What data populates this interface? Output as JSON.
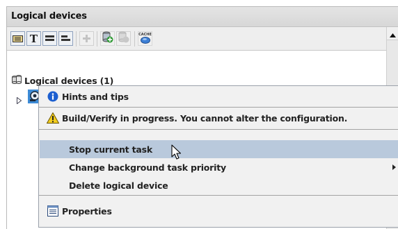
{
  "panel": {
    "title": "Logical devices"
  },
  "toolbar": {
    "buttons": [
      {
        "name": "device-view-icon",
        "label": ""
      },
      {
        "name": "text-view-icon",
        "label": "T"
      },
      {
        "name": "list-view-icon",
        "label": ""
      },
      {
        "name": "compact-view-icon",
        "label": ""
      },
      {
        "name": "add-icon",
        "label": ""
      },
      {
        "name": "add-device-icon",
        "label": ""
      },
      {
        "name": "remove-device-icon",
        "label": ""
      },
      {
        "name": "cache-icon",
        "label": "CACHE"
      }
    ]
  },
  "tree": {
    "root_label": "Logical devices (1)"
  },
  "context_menu": {
    "items": [
      {
        "label": "Hints and tips",
        "icon": "info-icon"
      },
      {
        "label": "Build/Verify in progress. You cannot alter the configuration.",
        "icon": "warning-icon"
      },
      {
        "label": "Stop current task",
        "selected": true
      },
      {
        "label": "Change background task priority",
        "submenu": true
      },
      {
        "label": "Delete logical device"
      },
      {
        "label": "Properties",
        "icon": "properties-icon"
      }
    ]
  },
  "colors": {
    "selection": "#b9c9dc",
    "menu_bg": "#f1f1f1",
    "header_bg": "#dcdcdc",
    "info_blue": "#1c5fd0",
    "warning_yellow": "#f2cd1f"
  }
}
